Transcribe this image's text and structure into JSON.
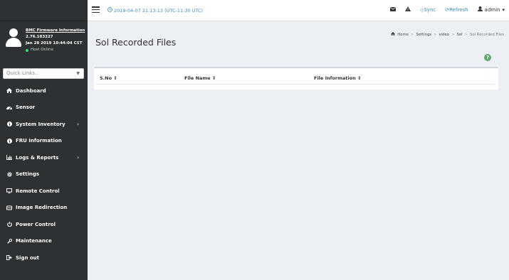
{
  "header": {
    "datetime": "2019-04-07 21:13:13 (UTC-11:30 UTC)",
    "sync_label": "Sync",
    "refresh_label": "Refresh",
    "user_label": "admin"
  },
  "sidebar": {
    "info_title": "BMC Firmware Information",
    "version": "2.76.183227",
    "build_date": "Jan 28 2019 10:44:04 CST",
    "host_status": "Host Online",
    "quick_links_placeholder": "Quick Links..",
    "items": [
      {
        "label": "Dashboard",
        "icon": "dashboard-icon"
      },
      {
        "label": "Sensor",
        "icon": "sensor-icon"
      },
      {
        "label": "System Inventory",
        "icon": "info-icon",
        "has_submenu": true
      },
      {
        "label": "FRU Information",
        "icon": "info-icon"
      },
      {
        "label": "Logs & Reports",
        "icon": "chart-icon",
        "has_submenu": true
      },
      {
        "label": "Settings",
        "icon": "gear-icon"
      },
      {
        "label": "Remote Control",
        "icon": "monitor-icon"
      },
      {
        "label": "Image Redirection",
        "icon": "disc-icon"
      },
      {
        "label": "Power Control",
        "icon": "power-icon"
      },
      {
        "label": "Maintenance",
        "icon": "wrench-icon"
      },
      {
        "label": "Sign out",
        "icon": "sign-out-icon"
      }
    ]
  },
  "page": {
    "title": "Sol Recorded Files",
    "breadcrumb": [
      "Home",
      "Settings",
      "video",
      "Sol",
      "Sol Recorded Files"
    ]
  },
  "table": {
    "columns": [
      "S.No",
      "File Name",
      "File Information"
    ],
    "rows": []
  },
  "colors": {
    "sidebar_bg": "#2d3133",
    "accent": "#3c8dbc",
    "status_online": "#3bd66d",
    "help_badge": "#5fa86e"
  }
}
